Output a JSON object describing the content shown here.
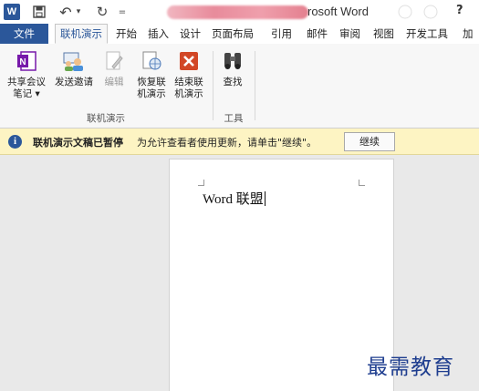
{
  "titlebar": {
    "app_logo": "W",
    "undo_glyph": "↶",
    "redo_glyph": "↻",
    "dropdown_glyph": "▾",
    "customize_glyph": "=",
    "title": "rosoft Word",
    "help": "?"
  },
  "tabs": {
    "file": "文件",
    "active": "联机演示",
    "others": [
      "开始",
      "插入",
      "设计",
      "页面布局",
      "引用",
      "邮件",
      "审阅",
      "视图",
      "开发工具",
      "加"
    ]
  },
  "ribbon": {
    "buttons": [
      {
        "label_line1": "共享会议",
        "label_line2": "笔记 ▾",
        "icon": "onenote-icon"
      },
      {
        "label_line1": "发送邀请",
        "label_line2": "",
        "icon": "send-invite-icon"
      },
      {
        "label_line1": "编辑",
        "label_line2": "",
        "icon": "edit-icon"
      },
      {
        "label_line1": "恢复联",
        "label_line2": "机演示",
        "icon": "resume-online-icon"
      },
      {
        "label_line1": "结束联",
        "label_line2": "机演示",
        "icon": "end-online-icon"
      },
      {
        "label_line1": "查找",
        "label_line2": "",
        "icon": "binoculars-icon"
      }
    ],
    "group_online": "联机演示",
    "group_tools": "工具"
  },
  "infobar": {
    "icon": "i",
    "title": "联机演示文稿已暂停",
    "message": "为允许查看者使用更新，请单击\"继续\"。",
    "continue_label": "继续"
  },
  "document": {
    "text": "Word 联盟"
  },
  "watermark": "最需教育",
  "colors": {
    "accent": "#2b579a",
    "infobar_bg": "#fdf4c3",
    "end_button": "#d24726",
    "onenote": "#7719aa",
    "watermark": "#1f3e8f"
  }
}
